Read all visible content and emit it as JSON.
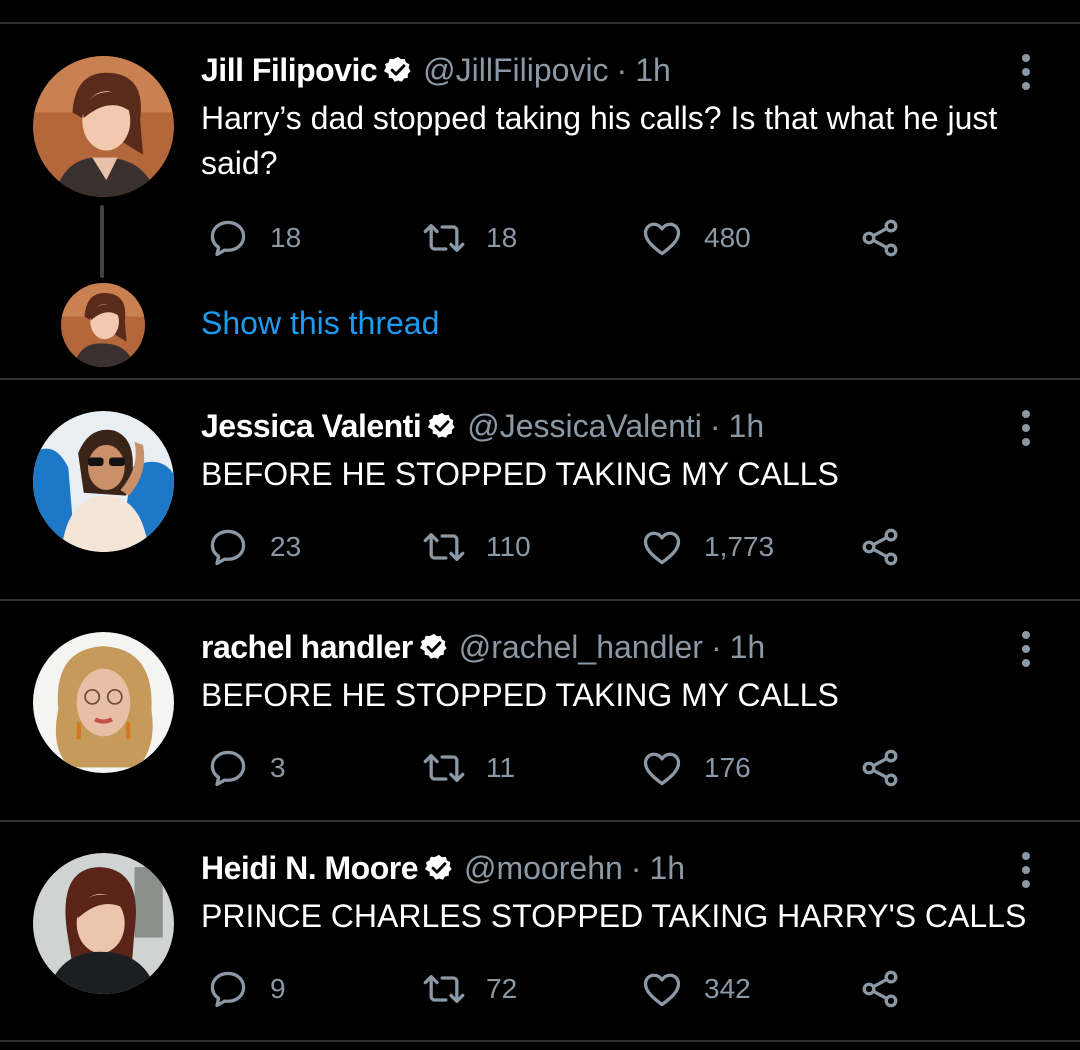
{
  "tweets": [
    {
      "name": "Jill Filipovic",
      "handle": "@JillFilipovic",
      "time": "1h",
      "text": "Harry’s dad stopped taking his calls? Is that what he just said?",
      "replies": "18",
      "retweets": "18",
      "likes": "480",
      "show_thread": "Show this thread"
    },
    {
      "name": "Jessica Valenti",
      "handle": "@JessicaValenti",
      "time": "1h",
      "text": "BEFORE HE STOPPED TAKING MY CALLS",
      "replies": "23",
      "retweets": "110",
      "likes": "1,773"
    },
    {
      "name": "rachel handler",
      "handle": "@rachel_handler",
      "time": "1h",
      "text": "BEFORE HE STOPPED TAKING MY CALLS",
      "replies": "3",
      "retweets": "11",
      "likes": "176"
    },
    {
      "name": "Heidi N. Moore",
      "handle": "@moorehn",
      "time": "1h",
      "text": "PRINCE CHARLES STOPPED TAKING HARRY'S CALLS",
      "replies": "9",
      "retweets": "72",
      "likes": "342"
    }
  ],
  "separator": "·",
  "icons": {
    "reply": "reply-icon",
    "retweet": "retweet-icon",
    "like": "heart-icon",
    "share": "share-icon",
    "verified": "verified-badge-icon",
    "more": "more-vertical-icon"
  },
  "colors": {
    "background": "#000000",
    "link": "#1d9bf0",
    "muted": "#8b98a5",
    "verified_badge": "#ffffff"
  }
}
